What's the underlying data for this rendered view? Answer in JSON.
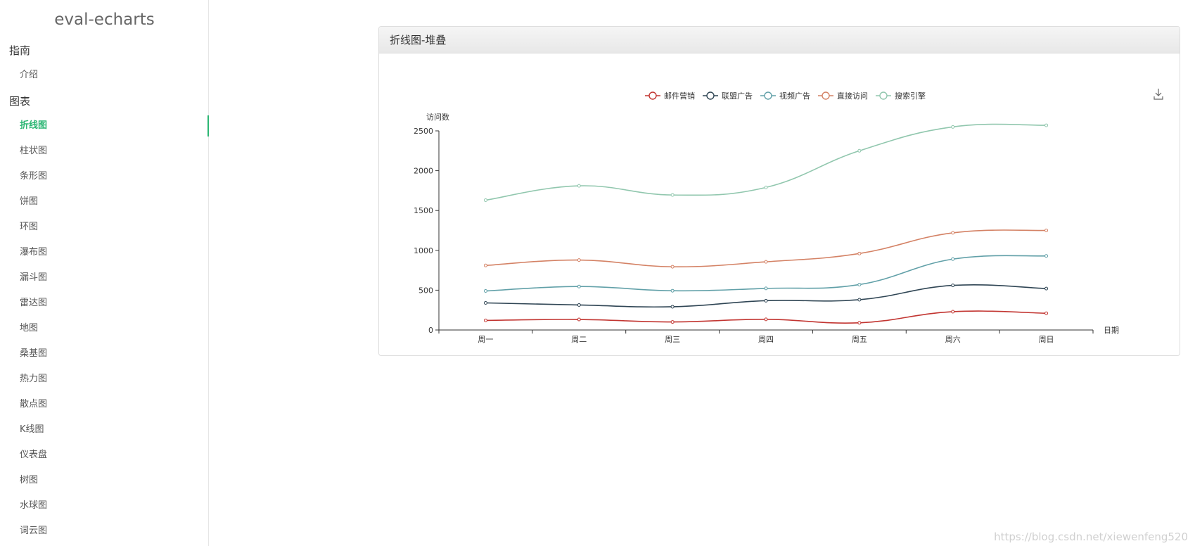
{
  "app": {
    "title": "eval-echarts"
  },
  "sidebar": {
    "sections": [
      {
        "header": "指南",
        "items": [
          {
            "label": "介绍",
            "active": false
          }
        ]
      },
      {
        "header": "图表",
        "items": [
          {
            "label": "折线图",
            "active": true
          },
          {
            "label": "柱状图",
            "active": false
          },
          {
            "label": "条形图",
            "active": false
          },
          {
            "label": "饼图",
            "active": false
          },
          {
            "label": "环图",
            "active": false
          },
          {
            "label": "瀑布图",
            "active": false
          },
          {
            "label": "漏斗图",
            "active": false
          },
          {
            "label": "雷达图",
            "active": false
          },
          {
            "label": "地图",
            "active": false
          },
          {
            "label": "桑基图",
            "active": false
          },
          {
            "label": "热力图",
            "active": false
          },
          {
            "label": "散点图",
            "active": false
          },
          {
            "label": "K线图",
            "active": false
          },
          {
            "label": "仪表盘",
            "active": false
          },
          {
            "label": "树图",
            "active": false
          },
          {
            "label": "水球图",
            "active": false
          },
          {
            "label": "词云图",
            "active": false
          }
        ]
      }
    ],
    "accent_color": "#2bb673"
  },
  "panel": {
    "title": "折线图-堆叠"
  },
  "toolbar": {
    "download_icon": "download-icon"
  },
  "watermark": "https://blog.csdn.net/xiewenfeng520",
  "chart_data": {
    "type": "line",
    "stacked": true,
    "smooth": true,
    "categories": [
      "周一",
      "周二",
      "周三",
      "周四",
      "周五",
      "周六",
      "周日"
    ],
    "xlabel": "日期",
    "ylabel": "访问数",
    "ylim": [
      0,
      2500
    ],
    "yticks": [
      0,
      500,
      1000,
      1500,
      2000,
      2500
    ],
    "legend_position": "top-center",
    "series": [
      {
        "name": "邮件营销",
        "color": "#c23531",
        "values": [
          120,
          132,
          101,
          134,
          90,
          230,
          210
        ]
      },
      {
        "name": "联盟广告",
        "color": "#2f4554",
        "values": [
          220,
          182,
          191,
          234,
          290,
          330,
          310
        ]
      },
      {
        "name": "视频广告",
        "color": "#61a0a8",
        "values": [
          150,
          232,
          201,
          154,
          190,
          330,
          410
        ]
      },
      {
        "name": "直接访问",
        "color": "#d48265",
        "values": [
          320,
          332,
          301,
          334,
          390,
          330,
          320
        ]
      },
      {
        "name": "搜索引擎",
        "color": "#91c7ae",
        "values": [
          820,
          932,
          901,
          934,
          1290,
          1330,
          1320
        ]
      }
    ]
  }
}
